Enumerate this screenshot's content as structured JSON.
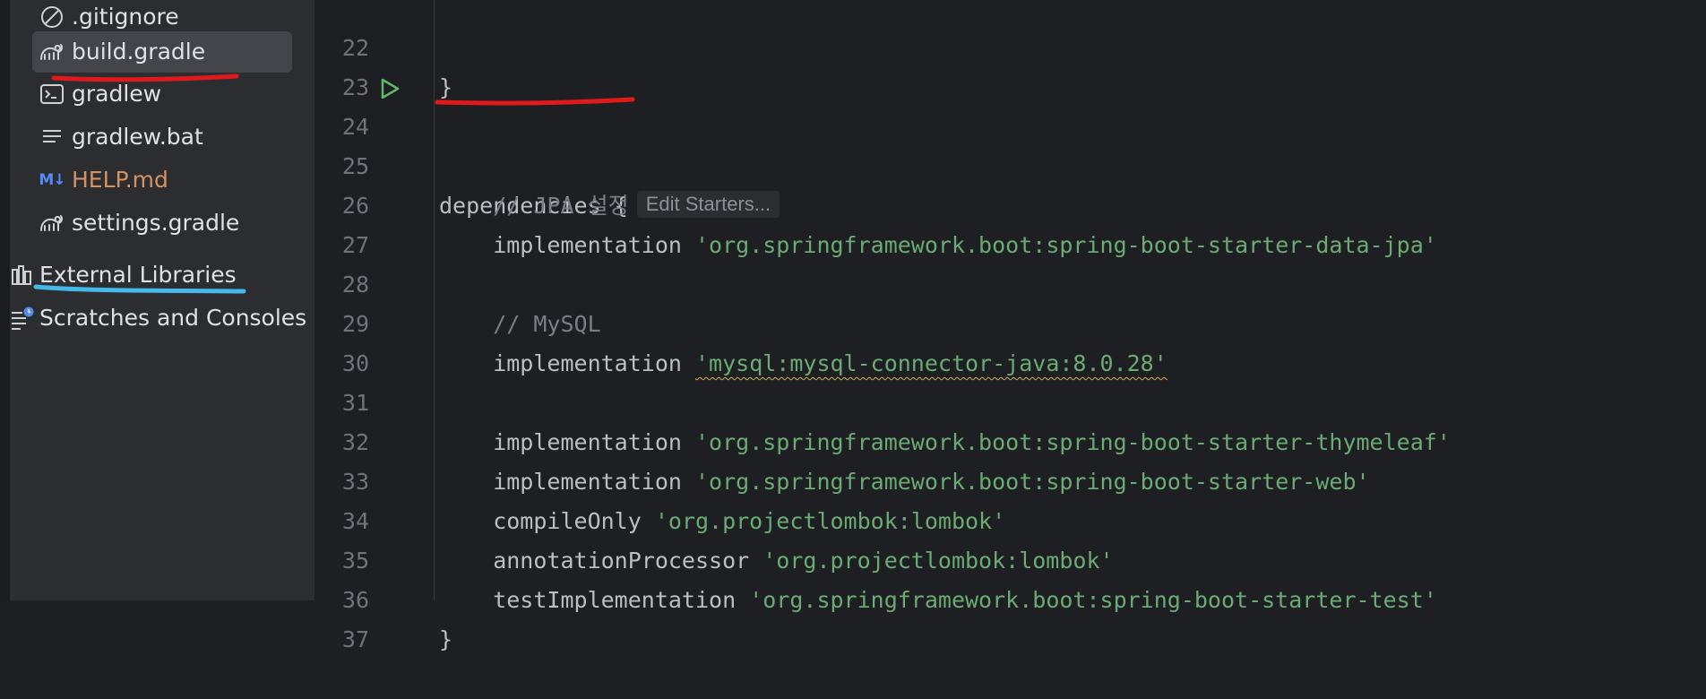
{
  "project_tree": {
    "items": [
      {
        "label": ".gitignore",
        "icon": "ignore-icon"
      },
      {
        "label": "build.gradle",
        "icon": "gradle-icon",
        "selected": true
      },
      {
        "label": "gradlew",
        "icon": "terminal-icon"
      },
      {
        "label": "gradlew.bat",
        "icon": "text-lines-icon"
      },
      {
        "label": "HELP.md",
        "icon": "markdown-icon",
        "icon_text": "M↓"
      },
      {
        "label": "settings.gradle",
        "icon": "gradle-icon"
      },
      {
        "label": "External Libraries",
        "icon": "library-icon"
      },
      {
        "label": "Scratches and Consoles",
        "icon": "scratches-icon"
      }
    ]
  },
  "editor": {
    "lines": [
      {
        "num": "22",
        "text": "}"
      },
      {
        "num": "23",
        "text": ""
      },
      {
        "num": "24",
        "keyword": "dependencies",
        "brace": " {",
        "hint": "Edit Starters..."
      },
      {
        "num": "25",
        "comment": "    // JPA 설정"
      },
      {
        "num": "26",
        "call": "    implementation ",
        "string": "'org.springframework.boot:spring-boot-starter-data-jpa'"
      },
      {
        "num": "27",
        "text": ""
      },
      {
        "num": "28",
        "comment": "    // MySQL"
      },
      {
        "num": "29",
        "call": "    implementation ",
        "string": "'mysql:mysql-connector-java:8.0.28'",
        "warning": true
      },
      {
        "num": "30",
        "text": ""
      },
      {
        "num": "31",
        "call": "    implementation ",
        "string": "'org.springframework.boot:spring-boot-starter-thymeleaf'"
      },
      {
        "num": "32",
        "call": "    implementation ",
        "string": "'org.springframework.boot:spring-boot-starter-web'"
      },
      {
        "num": "33",
        "call": "    compileOnly ",
        "string": "'org.projectlombok:lombok'"
      },
      {
        "num": "34",
        "call": "    annotationProcessor ",
        "string": "'org.projectlombok:lombok'"
      },
      {
        "num": "35",
        "call": "    testImplementation ",
        "string": "'org.springframework.boot:spring-boot-starter-test'"
      },
      {
        "num": "36",
        "text": "}"
      },
      {
        "num": "37",
        "text": ""
      }
    ]
  },
  "colors": {
    "annotation_red": "#e0191b",
    "annotation_blue": "#45b8e8"
  }
}
